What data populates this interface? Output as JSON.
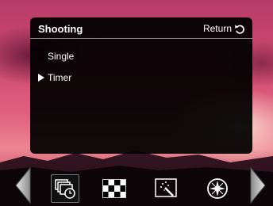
{
  "menu": {
    "title": "Shooting",
    "return_label": "Return",
    "items": [
      {
        "label": "Single",
        "selected": false
      },
      {
        "label": "Timer",
        "selected": true
      }
    ]
  },
  "toolbar": {
    "icons": [
      "self-timer-icon",
      "checkerboard-icon",
      "magic-wand-icon",
      "compass-icon"
    ],
    "selected_index": 0
  },
  "icons": {
    "return": "return-arrow-icon",
    "pointer": "triangle-pointer-icon",
    "nav_left": "left-arrow-icon",
    "nav_right": "right-arrow-icon"
  },
  "colors": {
    "text": "#ffffff",
    "panel": "#000000",
    "divider": "#8a8a8a"
  }
}
